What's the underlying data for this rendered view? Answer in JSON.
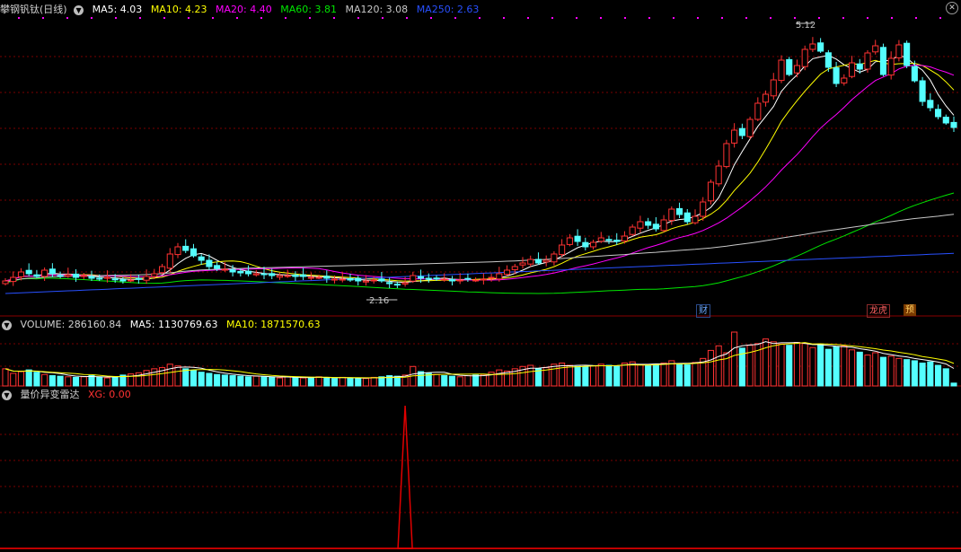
{
  "colors": {
    "up": "#ff3232",
    "down": "#54ffff",
    "ma5": "#ffffff",
    "ma10": "#ffff00",
    "ma20": "#ff00ff",
    "ma60": "#00e600",
    "ma120": "#c8c8c8",
    "ma250": "#2850ff",
    "grid": "#7a0000",
    "xg": "#e00000"
  },
  "main": {
    "stock": "攀钢钒钛(日线)",
    "ma5": "MA5: 4.03",
    "ma10": "MA10: 4.23",
    "ma20": "MA20: 4.40",
    "ma60": "MA60: 3.81",
    "ma120": "MA120: 3.08",
    "ma250": "MA250: 2.63",
    "high_label": "5.12",
    "low_label": "2.16",
    "events": [
      "财",
      "龙虎",
      "预"
    ]
  },
  "volume": {
    "label": "VOLUME: 286160.84",
    "ma5": "MA5: 1130769.63",
    "ma10": "MA10: 1871570.63"
  },
  "radar": {
    "title": "量价异变雷达",
    "xg": "XG: 0.00"
  },
  "chart_data": [
    {
      "type": "candlestick",
      "title": "攀钢钒钛(日线)",
      "ylim": [
        2.1,
        5.25
      ],
      "high": 5.12,
      "low": 2.16,
      "close": [
        2.32,
        2.36,
        2.42,
        2.4,
        2.37,
        2.44,
        2.4,
        2.38,
        2.39,
        2.36,
        2.38,
        2.35,
        2.34,
        2.36,
        2.34,
        2.32,
        2.33,
        2.34,
        2.37,
        2.4,
        2.48,
        2.62,
        2.7,
        2.66,
        2.6,
        2.55,
        2.48,
        2.46,
        2.45,
        2.42,
        2.41,
        2.4,
        2.4,
        2.39,
        2.38,
        2.38,
        2.38,
        2.37,
        2.37,
        2.36,
        2.36,
        2.35,
        2.34,
        2.34,
        2.33,
        2.32,
        2.32,
        2.33,
        2.32,
        2.29,
        2.28,
        2.3,
        2.38,
        2.35,
        2.34,
        2.35,
        2.34,
        2.32,
        2.33,
        2.34,
        2.33,
        2.34,
        2.36,
        2.4,
        2.44,
        2.48,
        2.52,
        2.56,
        2.52,
        2.55,
        2.62,
        2.72,
        2.8,
        2.76,
        2.7,
        2.75,
        2.8,
        2.78,
        2.76,
        2.82,
        2.92,
        2.98,
        2.94,
        2.9,
        3.0,
        3.12,
        3.06,
        2.98,
        3.04,
        3.2,
        3.42,
        3.6,
        3.85,
        4.0,
        3.94,
        4.12,
        4.3,
        4.4,
        4.56,
        4.78,
        4.62,
        4.72,
        4.9,
        4.96,
        4.88,
        4.7,
        4.52,
        4.58,
        4.75,
        4.68,
        4.86,
        4.94,
        4.62,
        4.8,
        4.95,
        4.72,
        4.55,
        4.32,
        4.25,
        4.15,
        4.08,
        4.03
      ],
      "ma5": "white",
      "ma10": "yellow",
      "ma20": "magenta",
      "ma60": "green",
      "ma120": "gray",
      "ma250": "blue"
    },
    {
      "type": "bar",
      "title": "VOLUME",
      "values": [
        0.3,
        0.22,
        0.25,
        0.28,
        0.24,
        0.2,
        0.18,
        0.17,
        0.16,
        0.15,
        0.16,
        0.18,
        0.15,
        0.14,
        0.16,
        0.19,
        0.21,
        0.23,
        0.27,
        0.3,
        0.32,
        0.38,
        0.35,
        0.3,
        0.27,
        0.24,
        0.22,
        0.2,
        0.19,
        0.18,
        0.17,
        0.16,
        0.17,
        0.16,
        0.15,
        0.14,
        0.16,
        0.15,
        0.14,
        0.15,
        0.16,
        0.14,
        0.13,
        0.15,
        0.14,
        0.14,
        0.13,
        0.15,
        0.16,
        0.18,
        0.17,
        0.19,
        0.34,
        0.25,
        0.22,
        0.2,
        0.18,
        0.17,
        0.16,
        0.18,
        0.19,
        0.2,
        0.24,
        0.28,
        0.26,
        0.3,
        0.34,
        0.36,
        0.3,
        0.32,
        0.38,
        0.4,
        0.36,
        0.34,
        0.33,
        0.35,
        0.38,
        0.36,
        0.34,
        0.4,
        0.42,
        0.37,
        0.36,
        0.38,
        0.4,
        0.44,
        0.39,
        0.37,
        0.41,
        0.48,
        0.62,
        0.7,
        0.58,
        0.94,
        0.66,
        0.71,
        0.74,
        0.82,
        0.77,
        0.73,
        0.71,
        0.76,
        0.74,
        0.67,
        0.72,
        0.64,
        0.69,
        0.7,
        0.63,
        0.59,
        0.54,
        0.58,
        0.5,
        0.52,
        0.48,
        0.46,
        0.44,
        0.4,
        0.42,
        0.36,
        0.3,
        0.05
      ]
    },
    {
      "type": "line",
      "title": "量价异变雷达",
      "series": [
        {
          "name": "XG",
          "values_note": "signal",
          "spike_index": 51,
          "spike_value": 1
        }
      ]
    }
  ]
}
